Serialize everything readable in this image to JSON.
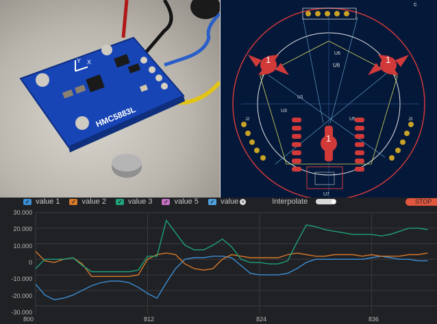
{
  "photo": {
    "board_label": "HMC5883L",
    "axis_x": "X",
    "axis_y": "Y"
  },
  "pcb": {
    "corner_mark": "c",
    "marker_left": "1",
    "marker_right": "1",
    "marker_center": "1",
    "ref_u6_top": "U6",
    "ref_u6": "U6",
    "ref_u1": "U1",
    "ref_u7": "U7",
    "ref_u5": "U5",
    "ref_u3": "U3",
    "ref_j_left": "J2",
    "ref_j_right": "J3"
  },
  "plotter": {
    "legend": [
      {
        "label": "value 1",
        "color": "#3b8fd6"
      },
      {
        "label": "value 2",
        "color": "#d97a2b"
      },
      {
        "label": "value 3",
        "color": "#1fa37a"
      },
      {
        "label": "value 5",
        "color": "#c46fc0"
      },
      {
        "label": "value",
        "color": "#4ea3e0"
      }
    ],
    "interpolate_label": "Interpolate",
    "stop_label": "STOP",
    "y_ticks": [
      "30.000",
      "20.000",
      "10.000",
      "0",
      "-10.000",
      "-20.000",
      "-30.000"
    ],
    "x_ticks": [
      "800",
      "812",
      "824",
      "836"
    ]
  },
  "chart_data": {
    "type": "line",
    "x": [
      800,
      801,
      802,
      803,
      804,
      805,
      806,
      807,
      808,
      809,
      810,
      811,
      812,
      813,
      814,
      815,
      816,
      817,
      818,
      819,
      820,
      821,
      822,
      823,
      824,
      825,
      826,
      827,
      828,
      829,
      830,
      831,
      832,
      833,
      834,
      835,
      836,
      837,
      838,
      839,
      840,
      841,
      842
    ],
    "series": [
      {
        "name": "value 1",
        "color": "#3b8fd6",
        "values": [
          -16000,
          -23000,
          -26000,
          -25000,
          -23000,
          -20000,
          -17000,
          -15000,
          -14000,
          -14000,
          -15000,
          -18000,
          -22000,
          -25000,
          -15000,
          -6000,
          0,
          1000,
          1000,
          2000,
          2000,
          1000,
          -4000,
          -9000,
          -10000,
          -10000,
          -10000,
          -9000,
          -6000,
          -2000,
          0,
          0,
          0,
          0,
          0,
          0,
          1000,
          2000,
          1000,
          0,
          0,
          -1000,
          -1000
        ]
      },
      {
        "name": "value 2",
        "color": "#d97a2b",
        "values": [
          5000,
          -1000,
          -2000,
          0,
          1000,
          -3000,
          -11000,
          -11000,
          -11000,
          -11000,
          -11000,
          -10000,
          0,
          3000,
          4000,
          3000,
          -3000,
          -6000,
          -7000,
          -6000,
          0,
          3000,
          2000,
          1000,
          1000,
          1000,
          1000,
          3000,
          4000,
          3000,
          2000,
          2000,
          3000,
          3000,
          3000,
          2000,
          3000,
          2000,
          2000,
          2000,
          3000,
          3000,
          4000
        ]
      },
      {
        "name": "value 3",
        "color": "#1fa37a",
        "values": [
          -6000,
          0,
          0,
          0,
          1000,
          -4000,
          -8000,
          -8000,
          -8000,
          -8000,
          -8000,
          -7000,
          2000,
          2000,
          25000,
          17000,
          9000,
          6000,
          6000,
          9000,
          13000,
          8000,
          0,
          -2000,
          -2000,
          -3000,
          -3000,
          -1000,
          11000,
          22000,
          21000,
          19000,
          18000,
          17000,
          16000,
          16000,
          16000,
          15000,
          16000,
          18000,
          20000,
          20000,
          19000
        ]
      }
    ],
    "ylim": [
      -35000,
      30000
    ],
    "xlim": [
      800,
      843
    ],
    "grid": true,
    "legend": "top"
  }
}
